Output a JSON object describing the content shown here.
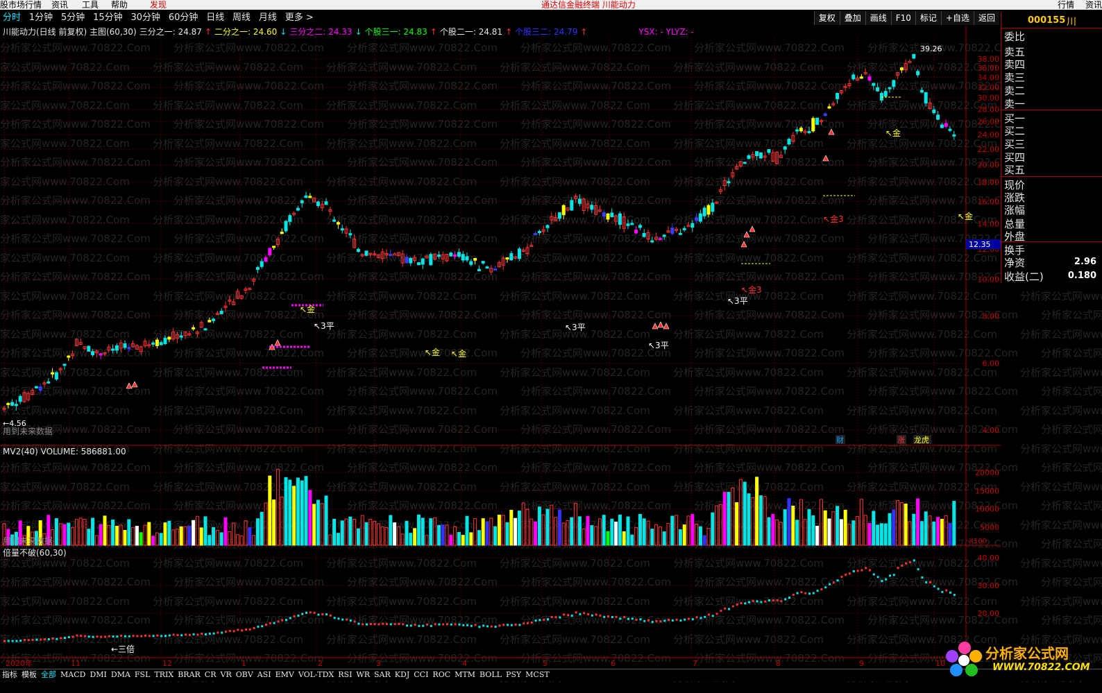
{
  "menubar": {
    "items": [
      "股市场行情",
      "资讯",
      "工具",
      "帮助",
      "发现"
    ],
    "center_title": "通达信金融终端   川能动力",
    "right_items": [
      "行情",
      "资讯"
    ]
  },
  "periods": {
    "items": [
      "分时",
      "1分钟",
      "5分钟",
      "15分钟",
      "30分钟",
      "60分钟",
      "日线",
      "周线",
      "月线",
      "更多 >"
    ],
    "active": "分时"
  },
  "toolbar": {
    "buttons": [
      "复权",
      "叠加",
      "画线",
      "F10",
      "标记",
      "+自选",
      "返回"
    ]
  },
  "main_info": {
    "title": "川能动力(日线 前复权) 主图(60,30)",
    "f1_label": "三分之一: 24.87",
    "f2_label": "二分之一: 24.60",
    "f3_label": "三分之二: 24.33",
    "f4_label": "个股三一: 24.83",
    "f5_label": "个股二一: 24.81",
    "f6_label": "个股三二: 24.79",
    "f7_label": "YSX: -  YLYZ: -",
    "future_note": "用到未来数据",
    "min_label": "4.56",
    "max_label": "39.26",
    "last_price": "12.35"
  },
  "volume_info": {
    "title": "MV2(40)  VOLUME: 586881.00",
    "future_note": "用到未来数据",
    "unit": "X100"
  },
  "ind_info": {
    "title": "倍量不破(60,30)",
    "note": "三倍"
  },
  "price_axis": [
    "38.00",
    "36.00",
    "34.00",
    "32.00",
    "30.00",
    "28.00",
    "26.00",
    "24.00",
    "22.00",
    "20.00",
    "18.00",
    "16.00",
    "14.00",
    "12.00",
    "10.00",
    "8.00",
    "6.00",
    "4.00"
  ],
  "vol_axis": [
    "20000",
    "15000",
    "10000",
    "5000"
  ],
  "ind_axis": [
    "40.00",
    "30.00",
    "20.00"
  ],
  "x_labels": [
    "2020年",
    "11",
    "12",
    "1",
    "2",
    "3",
    "4",
    "5",
    "6",
    "7",
    "8",
    "9",
    "10"
  ],
  "event_markers": [
    "财",
    "涨",
    "龙虎"
  ],
  "chart_labels": {
    "gold": "金",
    "gold3": "金3",
    "flat3": "3平"
  },
  "right_panel": {
    "code": "000155",
    "name": "川",
    "rows": [
      "委比",
      "卖五",
      "卖四",
      "卖三",
      "卖二",
      "卖一",
      "买一",
      "买二",
      "买三",
      "买四",
      "买五",
      "现价",
      "涨跌",
      "涨幅",
      "总量",
      "外盘",
      "换手",
      "净资",
      "收益(二)"
    ],
    "net_assets": "2.96",
    "eps": "0.180"
  },
  "tabs": {
    "items": [
      "指标",
      "模板",
      "全部",
      "MACD",
      "DMI",
      "DMA",
      "FSL",
      "TRIX",
      "BRAR",
      "CR",
      "VR",
      "OBV",
      "ASI",
      "EMV",
      "VOL-TDX",
      "RSI",
      "WR",
      "SAR",
      "KDJ",
      "CCI",
      "ROC",
      "MTM",
      "BOLL",
      "PSY",
      "MCST"
    ],
    "selected": "全部"
  },
  "watermark": "分析家公式网www.70822.Com",
  "logo": {
    "brand": "分析家公式网",
    "url": "WWW.70822.COM"
  },
  "colors": {
    "up": "#ff3232",
    "down": "#00e6e6",
    "magenta": "#ff00ff",
    "yellow": "#ffff00",
    "grid": "#8b0000",
    "axis_text": "#c00000"
  }
}
